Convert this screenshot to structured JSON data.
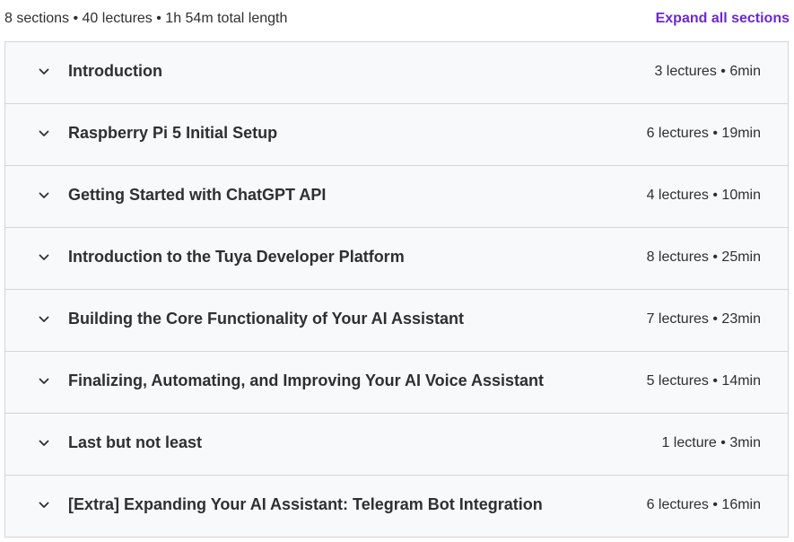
{
  "summary": {
    "text": "8 sections • 40 lectures • 1h 54m total length",
    "expand_label": "Expand all sections"
  },
  "colors": {
    "accent": "#6d28d2",
    "row_background": "#f7f9fa",
    "border": "#d1d7dc",
    "text": "#2d2f31"
  },
  "sections": [
    {
      "title": "Introduction",
      "meta": "3 lectures • 6min",
      "icon": "chevron-down-icon"
    },
    {
      "title": "Raspberry Pi 5 Initial Setup",
      "meta": "6 lectures • 19min",
      "icon": "chevron-down-icon"
    },
    {
      "title": "Getting Started with ChatGPT API",
      "meta": "4 lectures • 10min",
      "icon": "chevron-down-icon"
    },
    {
      "title": "Introduction to the Tuya Developer Platform",
      "meta": "8 lectures • 25min",
      "icon": "chevron-down-icon"
    },
    {
      "title": "Building the Core Functionality of Your AI Assistant",
      "meta": "7 lectures • 23min",
      "icon": "chevron-down-icon"
    },
    {
      "title": "Finalizing, Automating, and Improving Your AI Voice Assistant",
      "meta": "5 lectures • 14min",
      "icon": "chevron-down-icon"
    },
    {
      "title": "Last but not least",
      "meta": "1 lecture • 3min",
      "icon": "chevron-down-icon"
    },
    {
      "title": "[Extra] Expanding Your AI Assistant: Telegram Bot Integration",
      "meta": "6 lectures • 16min",
      "icon": "chevron-down-icon"
    }
  ]
}
